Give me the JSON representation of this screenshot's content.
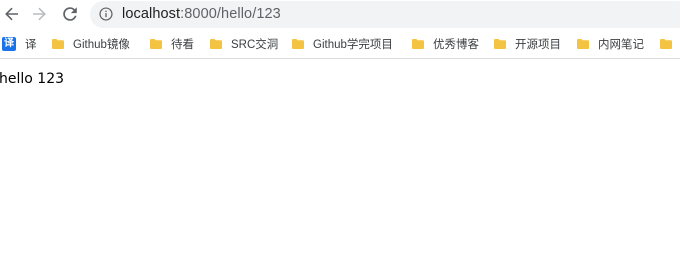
{
  "browser": {
    "address_bar": {
      "host": "localhost",
      "path": ":8000/hello/123"
    }
  },
  "bookmarks": [
    {
      "label": "译",
      "icon": "translate-icon"
    },
    {
      "label": "Github镜像",
      "icon": "folder-icon"
    },
    {
      "label": "待看",
      "icon": "folder-icon"
    },
    {
      "label": "SRC交洞",
      "icon": "folder-icon"
    },
    {
      "label": "Github学完项目",
      "icon": "folder-icon"
    },
    {
      "label": "优秀博客",
      "icon": "folder-icon"
    },
    {
      "label": "开源项目",
      "icon": "folder-icon"
    },
    {
      "label": "内网笔记",
      "icon": "folder-icon"
    },
    {
      "label": "",
      "icon": "folder-icon"
    }
  ],
  "page": {
    "text": "hello 123"
  },
  "colors": {
    "omnibox_bg": "#f1f3f4",
    "folder": "#f5c342",
    "translate_badge": "#1a73e8"
  }
}
